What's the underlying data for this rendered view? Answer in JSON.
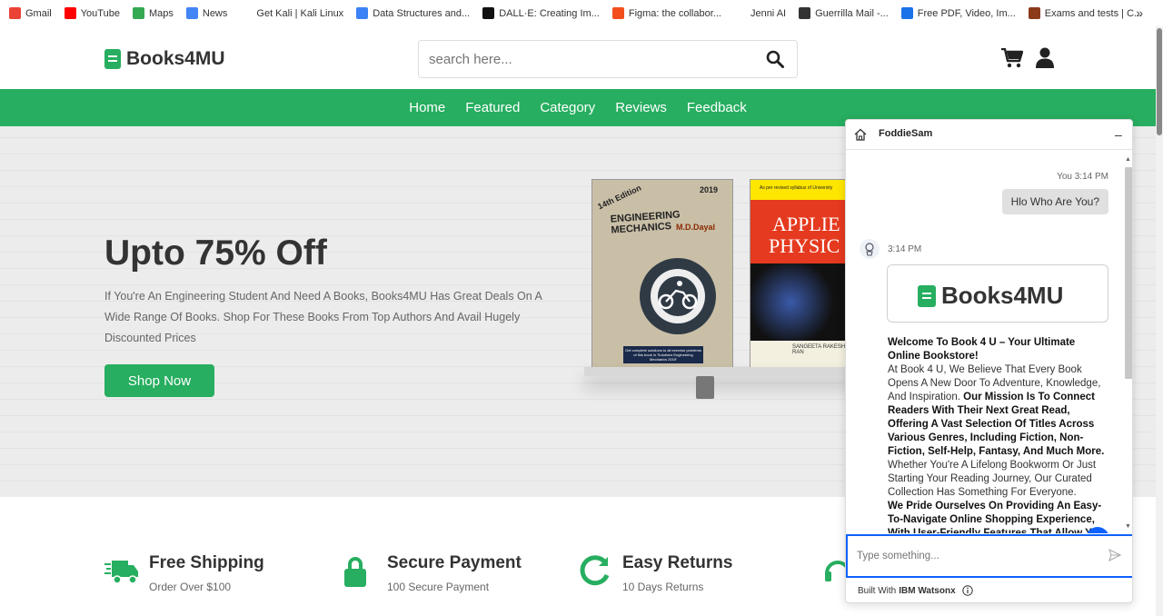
{
  "bookmarks": [
    {
      "label": "Gmail",
      "icon": "gmail-icon",
      "color": "#ea4335"
    },
    {
      "label": "YouTube",
      "icon": "youtube-icon",
      "color": "#ff0000"
    },
    {
      "label": "Maps",
      "icon": "maps-icon",
      "color": "#34a853"
    },
    {
      "label": "News",
      "icon": "news-icon",
      "color": "#4285f4"
    },
    {
      "label": "Get Kali | Kali Linux",
      "icon": "kali-icon",
      "color": "#ffffff"
    },
    {
      "label": "Data Structures and...",
      "icon": "ds-icon",
      "color": "#3b82f6"
    },
    {
      "label": "DALL·E: Creating Im...",
      "icon": "openai-icon",
      "color": "#111111"
    },
    {
      "label": "Figma: the collabor...",
      "icon": "figma-icon",
      "color": "#f24e1e"
    },
    {
      "label": "Jenni AI",
      "icon": "jenni-icon",
      "color": "#ffffff"
    },
    {
      "label": "Guerrilla Mail -...",
      "icon": "guerrilla-icon",
      "color": "#333333"
    },
    {
      "label": "Free PDF, Video, Im...",
      "icon": "pdf-icon",
      "color": "#1a73e8"
    },
    {
      "label": "Exams and tests | C...",
      "icon": "exams-icon",
      "color": "#8b3a1a"
    }
  ],
  "bookmarks_more": "»",
  "brand": {
    "name": "Books4MU",
    "accent": "#27ae60"
  },
  "search": {
    "placeholder": "search here..."
  },
  "nav": [
    "Home",
    "Featured",
    "Category",
    "Reviews",
    "Feedback"
  ],
  "hero": {
    "title": "Upto 75% Off",
    "description": "If You're An Engineering Student And Need A Books, Books4MU Has Great Deals On A Wide Range Of Books. Shop For These Books From Top Authors And Avail Hugely Discounted Prices",
    "button": "Shop Now"
  },
  "books": [
    {
      "year": "2019",
      "edition": "14th Edition",
      "title": "ENGINEERING MECHANICS",
      "author": "M.D.Dayal",
      "footer": "Get complete solutions to all exercise problems of this book in 'Solutions Engineering Mechanics 2019'"
    },
    {
      "top": "As per revised syllabus of University",
      "title1": "APPLIE",
      "title2": "PHYSIC",
      "author": "SANGEETA RAKESH RAN"
    }
  ],
  "features": [
    {
      "title": "Free Shipping",
      "subtitle": "Order Over $100",
      "icon": "truck-icon"
    },
    {
      "title": "Secure Payment",
      "subtitle": "100 Secure Payment",
      "icon": "lock-icon"
    },
    {
      "title": "Easy Returns",
      "subtitle": "10 Days Returns",
      "icon": "return-icon"
    },
    {
      "icon": "headset-icon"
    }
  ],
  "chat": {
    "bot_name": "FoddieSam",
    "minimize": "–",
    "user_time": "You 3:14 PM",
    "user_message": "Hlo Who Are You?",
    "bot_time": "3:14 PM",
    "bot_logo": "Books4MU",
    "welcome_title": "Welcome To Book 4 U – Your Ultimate Online Bookstore!",
    "welcome_body": "At Book 4 U, We Believe That Every Book Opens A New Door To Adventure, Knowledge, And Inspiration.",
    "mission": "Our Mission Is To Connect Readers With Their Next Great Read, Offering A Vast Selection Of Titles Across Various Genres, Including Fiction, Non-Fiction, Self-Help, Fantasy, And Much More.",
    "lifelong": "Whether You're A Lifelong Bookworm Or Just Starting Your Reading Journey, Our Curated Collection Has Something For Everyone.",
    "pride": "We Pride Ourselves On Providing An Easy-To-Navigate Online Shopping Experience, With User-Friendly Features That Allow You",
    "help": "?",
    "input_placeholder": "Type something...",
    "footer_prefix": "Built With",
    "footer_brand": "IBM Watsonx",
    "accent": "#0f62fe"
  }
}
